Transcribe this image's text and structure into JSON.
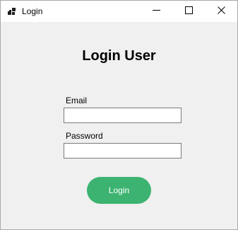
{
  "window": {
    "title": "Login"
  },
  "form": {
    "heading": "Login User",
    "email_label": "Email",
    "email_value": "",
    "password_label": "Password",
    "password_value": "",
    "login_label": "Login"
  },
  "colors": {
    "login_button": "#3cb371",
    "client_background": "#f0f0f0"
  },
  "icons": {
    "app": "app-window-icon",
    "minimize": "minimize-icon",
    "maximize": "maximize-icon",
    "close": "close-icon"
  }
}
